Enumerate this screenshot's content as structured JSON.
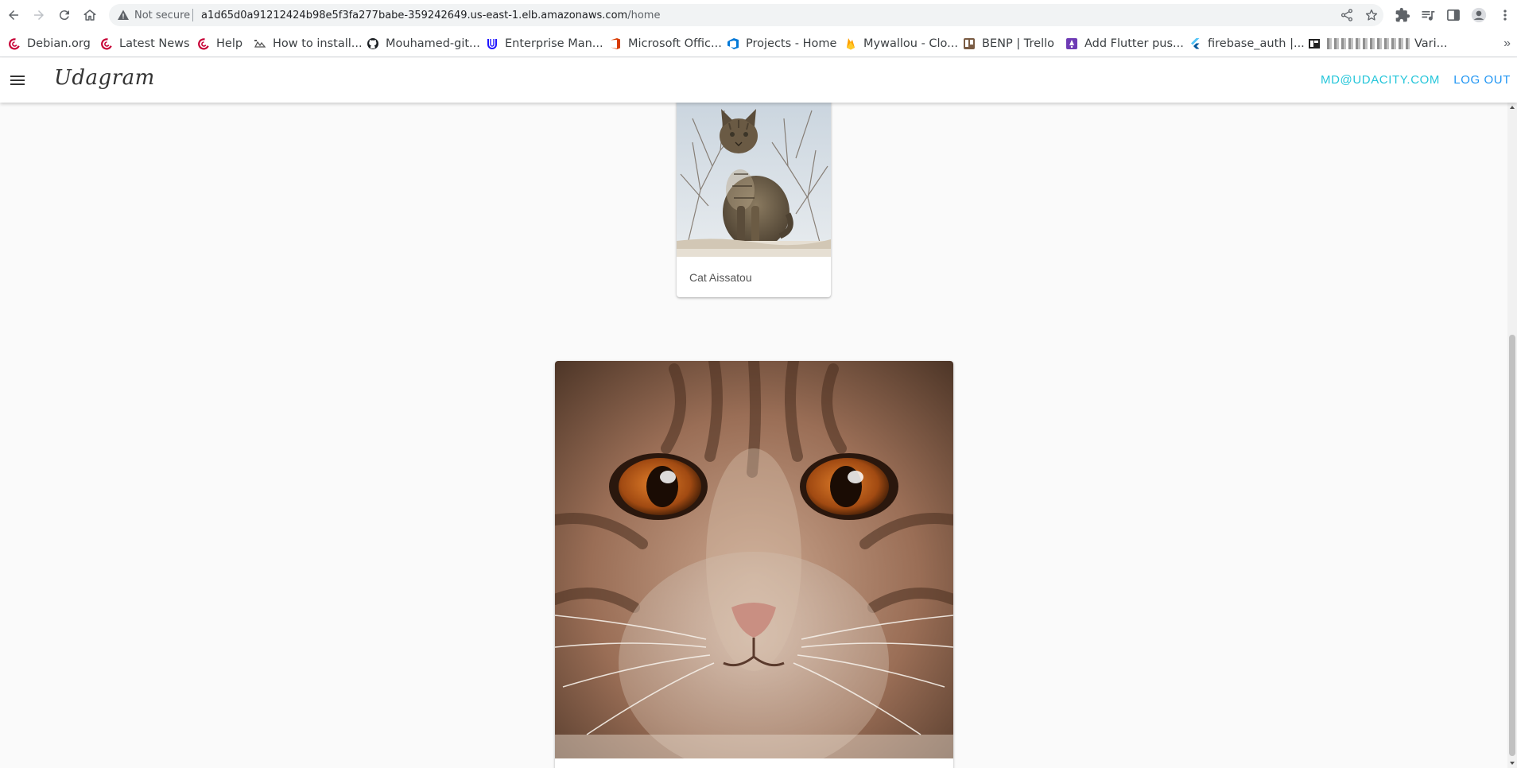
{
  "browser": {
    "security_label": "Not secure",
    "url_host": "a1d65d0a91212424b98e5f3fa277babe-359242649.us-east-1.elb.amazonaws.com",
    "url_path": "/home"
  },
  "bookmarks": [
    {
      "label": "Debian.org",
      "icon": "debian-icon"
    },
    {
      "label": "Latest News",
      "icon": "debian-icon"
    },
    {
      "label": "Help",
      "icon": "debian-icon"
    },
    {
      "label": "How to install...",
      "icon": "page-icon"
    },
    {
      "label": "Mouhamed-git...",
      "icon": "github-icon"
    },
    {
      "label": "Enterprise Man...",
      "icon": "udacity-icon"
    },
    {
      "label": "Microsoft Offic...",
      "icon": "office-icon"
    },
    {
      "label": "Projects - Home",
      "icon": "azure-devops-icon"
    },
    {
      "label": "Mywallou - Clo...",
      "icon": "firebase-icon"
    },
    {
      "label": "BENP | Trello",
      "icon": "trello-icon"
    },
    {
      "label": "Add Flutter pus...",
      "icon": "purple-icon"
    },
    {
      "label": "firebase_auth |...",
      "icon": "flutter-icon"
    },
    {
      "label": "Vari...",
      "icon": "page-icon"
    }
  ],
  "app": {
    "brand": "Udagram",
    "user_email": "MD@UDACITY.COM",
    "logout_label": "LOG OUT"
  },
  "feed": [
    {
      "caption": "Cat Aissatou"
    },
    {
      "caption": ""
    }
  ],
  "colors": {
    "accent_cyan": "#26c6da",
    "accent_blue": "#2196f3",
    "background": "#fafafa"
  }
}
